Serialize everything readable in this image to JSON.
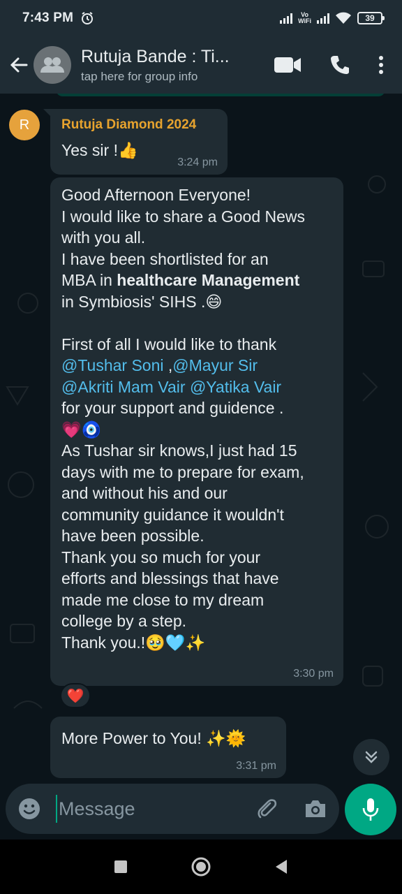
{
  "status_bar": {
    "time": "7:43 PM",
    "vowifi_top": "Vo",
    "vowifi_bottom": "WiFi",
    "battery": "39"
  },
  "header": {
    "title": "Rutuja Bande : Ti...",
    "subtitle": "tap here for group info"
  },
  "messages": {
    "m1": {
      "avatar_letter": "R",
      "sender": "Rutuja Diamond 2024",
      "text": "Yes sir !👍",
      "time": "3:24 pm"
    },
    "m2": {
      "l1": "Good Afternoon Everyone!",
      "l2": "I would like to share a Good News",
      "l3": "with you all.",
      "l4": "I have been shortlisted for an",
      "l5a": "MBA in ",
      "l5b": "healthcare Management",
      "l6": "in Symbiosis' SIHS .😄",
      "l7": "First of all I would like to thank",
      "m_tushar": "@Tushar Soni",
      "sep1": " ,",
      "m_mayur": "@Mayur Sir",
      "m_akriti": "@Akriti Mam Vair",
      "sep2": " ",
      "m_yatika": "@Yatika Vair",
      "l9": "for your support and guidence .",
      "l10": "💗🧿",
      "l11": " As Tushar sir knows,I just had 15",
      "l12": "days with me to prepare for exam,",
      "l13": "and without his and our",
      "l14": "community guidance it wouldn't",
      "l15": "have been possible.",
      "l16": "Thank you so much for your",
      "l17": "efforts and blessings that have",
      "l18": "made me close to my dream",
      "l19": "college by a step.",
      "l20": "Thank you.!🥹🩵✨",
      "time": "3:30 pm",
      "reaction": "❤️"
    },
    "m3": {
      "text": "More Power to You! ✨🌞",
      "time": "3:31 pm"
    }
  },
  "composer": {
    "placeholder": "Message"
  },
  "colors": {
    "accent": "#00a884",
    "sender_name": "#e7a32e",
    "mention": "#53bdeb",
    "bubble": "#202c33",
    "background": "#0b141a"
  }
}
